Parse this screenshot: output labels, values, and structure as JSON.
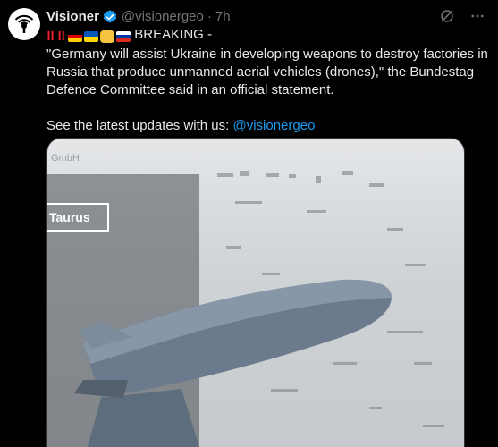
{
  "tweet": {
    "author_name": "Visioner",
    "handle": "@visionergeo",
    "separator": "·",
    "time": "7h",
    "breaking_label": "BREAKING -",
    "body_lines": [
      "\"Germany will assist Ukraine in developing weapons to destroy factories in",
      "Russia that produce unmanned aerial vehicles (drones),\" the Bundestag",
      "Defence Committee said in an official statement."
    ],
    "updates_prefix": "See the latest updates with us: ",
    "updates_mention": "@visionergeo",
    "emoji": [
      "double-exclamation-red",
      "double-exclamation-red",
      "flag-germany",
      "flag-ukraine",
      "fist-bump",
      "flag-russia"
    ]
  },
  "media": {
    "watermark_text": "GmbH",
    "overlay_label": "Taurus"
  },
  "colors": {
    "background": "#000000",
    "text": "#e7e9ea",
    "muted": "#71767b",
    "link": "#1d9bf0",
    "verified": "#1d9bf0"
  }
}
